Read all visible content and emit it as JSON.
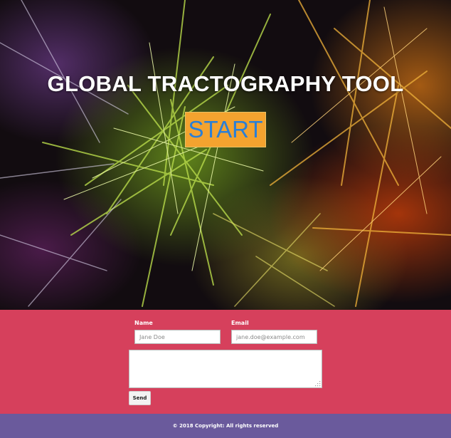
{
  "hero": {
    "title": "GLOBAL TRACTOGRAPHY TOOL",
    "start_label": "START",
    "background_image": "neural-fibers-image"
  },
  "contact_form": {
    "name_label": "Name",
    "name_placeholder": "Jane Doe",
    "email_label": "Email",
    "email_placeholder": "jane.doe@example.com",
    "message_value": "",
    "send_label": "Send"
  },
  "footer": {
    "copyright": "© 2018 Copyright: All rights reserved"
  },
  "colors": {
    "start_button_bg": "#f4a32f",
    "start_button_text": "#2a7fd6",
    "contact_bg": "#d6405c",
    "footer_bg": "#6a5a9c"
  }
}
